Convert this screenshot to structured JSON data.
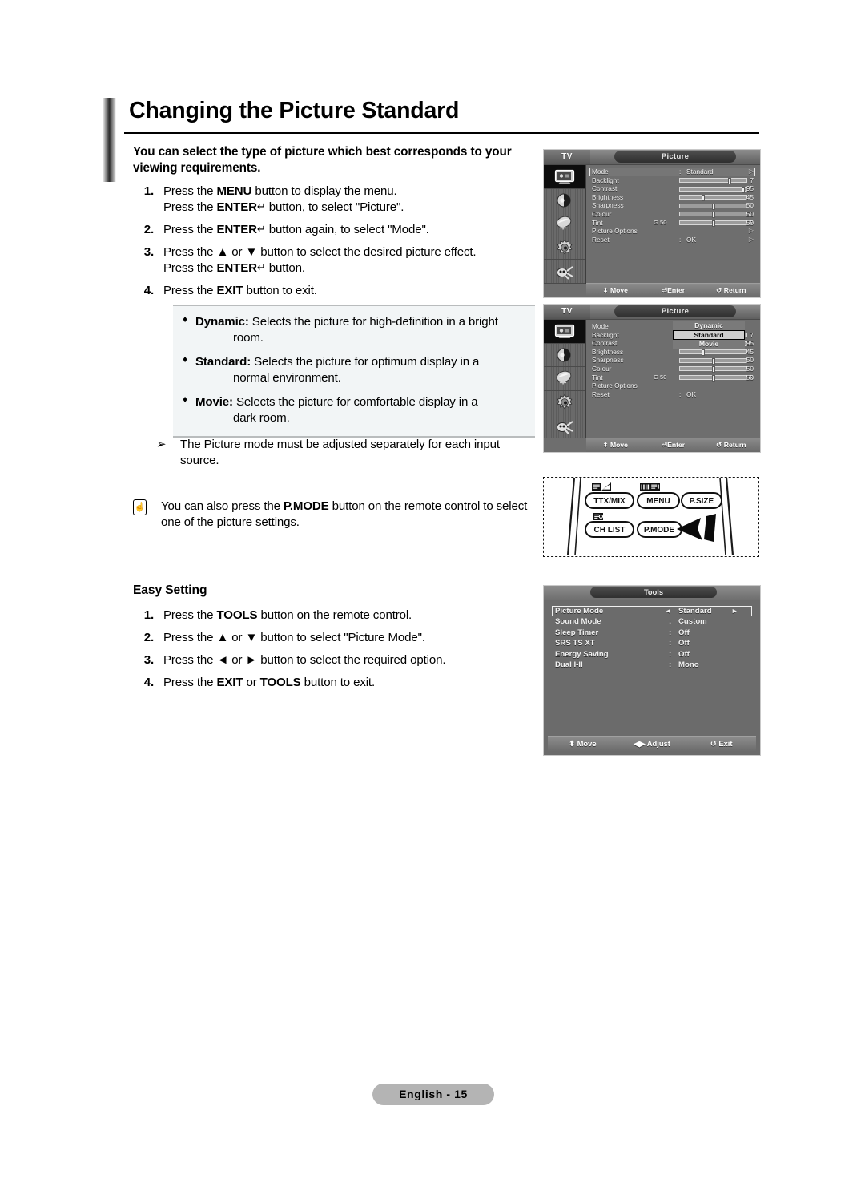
{
  "page": {
    "title": "Changing the Picture Standard",
    "footer_label": "English - 15"
  },
  "intro": "You can select the type of picture which best corresponds to your viewing requirements.",
  "steps": [
    {
      "num": "1.",
      "line1_a": "Press the ",
      "line1_b": "MENU",
      "line1_c": " button to display the menu.",
      "line2_a": "Press the ",
      "line2_b": "ENTER",
      "line2_c": " button, to select \"Picture\"."
    },
    {
      "num": "2.",
      "line1_a": "Press the ",
      "line1_b": "ENTER",
      "line1_c": " button again, to select \"Mode\"."
    },
    {
      "num": "3.",
      "line1_a": "Press the ▲ or ▼ button to select the desired picture effect.",
      "line2_a": "Press the ",
      "line2_b": "ENTER",
      "line2_c": " button."
    },
    {
      "num": "4.",
      "line1_a": "Press the ",
      "line1_b": "EXIT",
      "line1_c": " button to exit."
    }
  ],
  "bullets": [
    {
      "label": "Dynamic:",
      "text": " Selects the picture for high-definition in a bright",
      "cont": "room."
    },
    {
      "label": "Standard:",
      "text": " Selects the picture for optimum display in a",
      "cont": "normal environment."
    },
    {
      "label": "Movie:",
      "text": " Selects the picture for comfortable display in a",
      "cont": "dark room."
    }
  ],
  "notes": {
    "arrow_note": "The Picture mode must be adjusted separately for each input source.",
    "pmode_note_a": "You can also press the ",
    "pmode_note_b": "P.MODE",
    "pmode_note_c": " button on the remote control to select one of the picture settings."
  },
  "easy_setting": {
    "title": "Easy Setting",
    "steps": [
      {
        "num": "1.",
        "a": "Press the ",
        "b": "TOOLS",
        "c": " button on the remote control."
      },
      {
        "num": "2.",
        "a": "Press the ▲ or ▼ button to select \"Picture Mode\".",
        "b": "",
        "c": ""
      },
      {
        "num": "3.",
        "a": "Press the ◄ or ► button to select the required option.",
        "b": "",
        "c": ""
      },
      {
        "num": "4.",
        "a": "Press the ",
        "b": "EXIT",
        "c": " or ",
        "d": "TOOLS",
        "e": " button to exit."
      }
    ]
  },
  "osd_picture": {
    "tv_label": "TV",
    "menu_title": "Picture",
    "rows": [
      {
        "label": "Mode",
        "colon": ":",
        "value": "Standard",
        "arrow": "▷",
        "selected": true
      },
      {
        "label": "Backlight",
        "num": "7",
        "slider": 72
      },
      {
        "label": "Contrast",
        "num": "95",
        "slider": 95
      },
      {
        "label": "Brightness",
        "num": "45",
        "slider": 34
      },
      {
        "label": "Sharpness",
        "num": "50",
        "slider": 49
      },
      {
        "label": "Colour",
        "num": "50",
        "slider": 49
      },
      {
        "label": "Tint",
        "num": "50",
        "slider": 49,
        "tint_left": "G  50",
        "tint_right": "R"
      },
      {
        "label": "Picture Options",
        "arrow": "▷"
      },
      {
        "label": "Reset",
        "colon": ":",
        "value": "OK",
        "arrow": "▷"
      }
    ],
    "footer": [
      {
        "glyph": "⬍",
        "label": "Move"
      },
      {
        "glyph": "⏎",
        "label": "Enter"
      },
      {
        "glyph": "↺",
        "label": "Return"
      }
    ]
  },
  "osd_picture_dropdown": {
    "tv_label": "TV",
    "menu_title": "Picture",
    "options": [
      {
        "label": "Dynamic",
        "highlighted": false
      },
      {
        "label": "Standard",
        "highlighted": true
      },
      {
        "label": "Movie",
        "highlighted": false
      }
    ]
  },
  "remote": {
    "buttons": [
      {
        "label": "TTX/MIX",
        "icon": "teletext-mix-icon"
      },
      {
        "label": "MENU",
        "icon": "teletext-index-icon"
      },
      {
        "label": "P.SIZE",
        "icon": ""
      },
      {
        "label": "CH LIST",
        "icon": "teletext-subpage-icon"
      },
      {
        "label": "P.MODE",
        "icon": ""
      }
    ],
    "pointer": "pointer-arrow-icon"
  },
  "tools_menu": {
    "title": "Tools",
    "rows": [
      {
        "label": "Picture Mode",
        "value": "Standard",
        "selected": true,
        "left_arrow": "◄",
        "right_arrow": "►"
      },
      {
        "label": "Sound Mode",
        "value": "Custom",
        "selected": false,
        "sep": ":"
      },
      {
        "label": "Sleep Timer",
        "value": "Off",
        "selected": false,
        "sep": ":"
      },
      {
        "label": "SRS TS XT",
        "value": "Off",
        "selected": false,
        "sep": ":"
      },
      {
        "label": "Energy Saving",
        "value": "Off",
        "selected": false,
        "sep": ":"
      },
      {
        "label": "Dual I-II",
        "value": "Mono",
        "selected": false,
        "sep": ":"
      }
    ],
    "footer": [
      {
        "glyph": "⬍",
        "label": "Move"
      },
      {
        "glyph": "◀▶",
        "label": "Adjust"
      },
      {
        "glyph": "↺",
        "label": "Exit"
      }
    ]
  },
  "colors": {
    "osd_bg": "#6e6e6e",
    "highlight_bg": "#cfcfcf",
    "bullet_box_bg": "#f2f5f6",
    "footer_badge_bg": "#b4b4b4"
  }
}
